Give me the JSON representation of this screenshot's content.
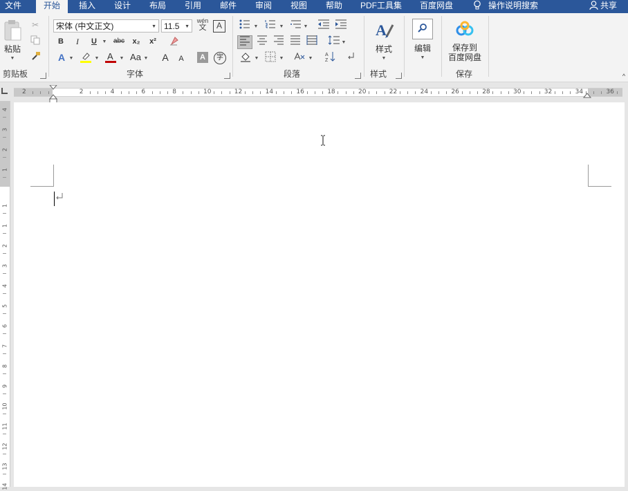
{
  "tabs": [
    "文件",
    "开始",
    "插入",
    "设计",
    "布局",
    "引用",
    "邮件",
    "审阅",
    "视图",
    "帮助",
    "PDF工具集",
    "百度网盘"
  ],
  "tell_me": "操作说明搜索",
  "share": "共享",
  "clipboard": {
    "paste": "粘贴",
    "group": "剪贴板"
  },
  "font": {
    "name": "宋体 (中文正文)",
    "size": "11.5",
    "group": "字体",
    "bold": "B",
    "italic": "I",
    "underline": "U",
    "strike": "abc",
    "sub": "x₂",
    "sup": "x²",
    "grow": "A",
    "shrink": "A",
    "case": "Aa",
    "phonetic": "wén",
    "phonetic_char": "文",
    "border_char": "A",
    "enclose": "字"
  },
  "paragraph": {
    "group": "段落"
  },
  "styles": {
    "label": "样式",
    "group": "样式"
  },
  "editing": {
    "label": "编辑"
  },
  "save": {
    "label_line1": "保存到",
    "label_line2": "百度网盘",
    "group": "保存"
  },
  "ruler": {
    "h_labels": [
      "2",
      "2",
      "4",
      "6",
      "8",
      "10",
      "12",
      "14",
      "16",
      "18",
      "20",
      "22",
      "24",
      "26",
      "28",
      "30",
      "32",
      "34",
      "36"
    ],
    "v_labels": [
      "4",
      "3",
      "2",
      "1",
      "1",
      "1",
      "2",
      "3",
      "4",
      "5",
      "6",
      "7",
      "8",
      "9",
      "10",
      "11",
      "12",
      "13",
      "14"
    ]
  },
  "colors": {
    "accent": "#2b579a",
    "highlight": "#ffff00",
    "font_color": "#c00000"
  },
  "icons": [
    "cut-icon",
    "copy-icon",
    "format-painter-icon",
    "clear-format-icon",
    "bullets-icon",
    "numbering-icon",
    "multilevel-icon",
    "decrease-indent-icon",
    "increase-indent-icon",
    "align-left-icon",
    "align-center-icon",
    "align-right-icon",
    "justify-icon",
    "distributed-icon",
    "line-spacing-icon",
    "shading-icon",
    "borders-icon",
    "chinese-layout-icon",
    "sort-icon",
    "show-marks-icon",
    "styles-icon",
    "find-icon",
    "baidu-cloud-icon",
    "lightbulb-icon",
    "user-icon"
  ]
}
